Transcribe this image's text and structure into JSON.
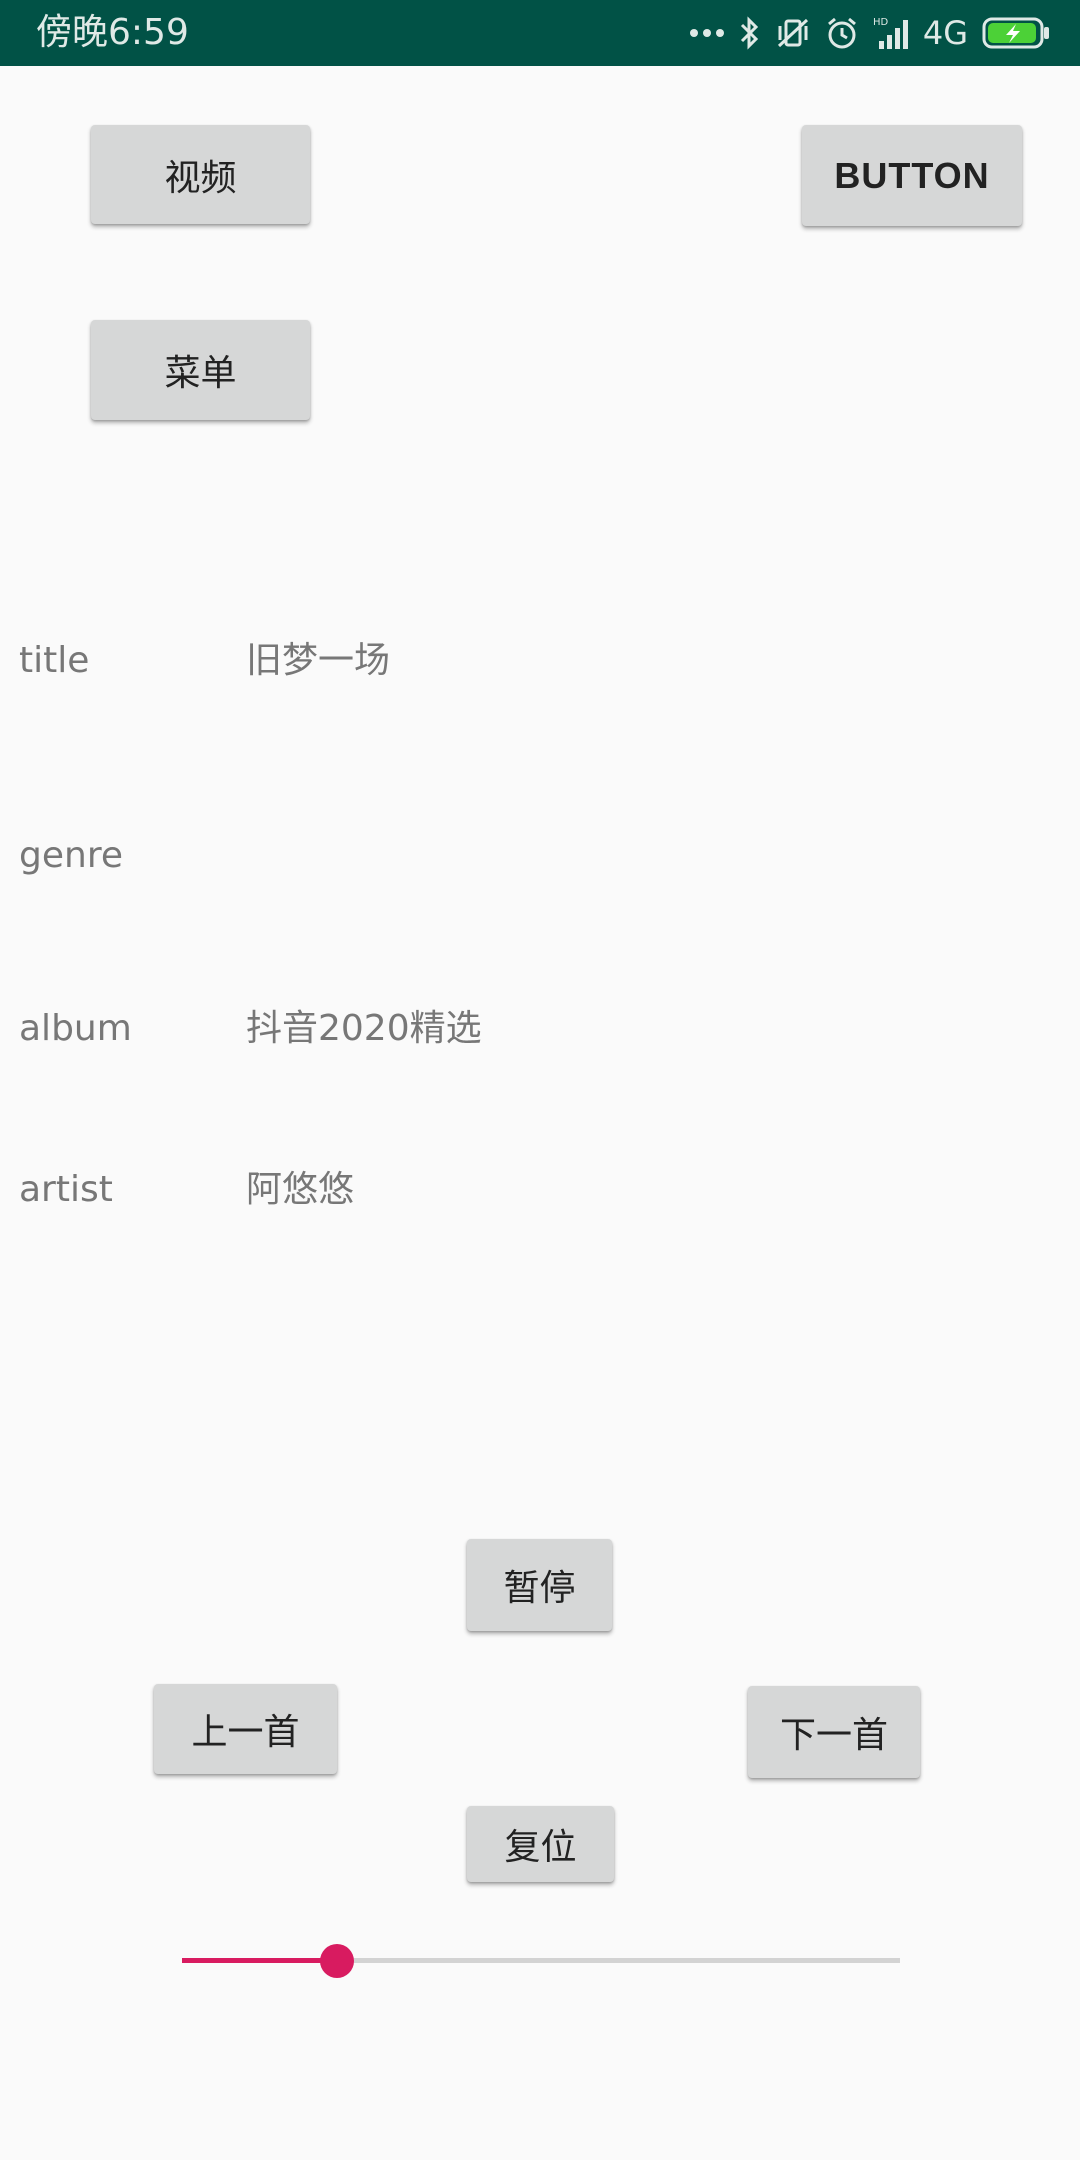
{
  "status_bar": {
    "time": "傍晚6:59",
    "network": "4G",
    "icons": [
      "dots-icon",
      "bluetooth-icon",
      "vibrate-off-icon",
      "alarm-icon",
      "hd-signal-icon",
      "battery-charging-icon"
    ],
    "colors": {
      "background": "#015246",
      "battery": "#4cd137"
    }
  },
  "top_buttons": {
    "video_label": "视频",
    "generic_label": "BUTTON",
    "menu_label": "菜单"
  },
  "metadata": {
    "title_label": "title",
    "title_value": "旧梦一场",
    "genre_label": "genre",
    "genre_value": "",
    "album_label": "album",
    "album_value": "抖音2020精选",
    "artist_label": "artist",
    "artist_value": "阿悠悠"
  },
  "controls": {
    "pause_label": "暂停",
    "prev_label": "上一首",
    "next_label": "下一首",
    "reset_label": "复位"
  },
  "progress": {
    "fraction": 0.216,
    "accent_color": "#d81b60"
  }
}
